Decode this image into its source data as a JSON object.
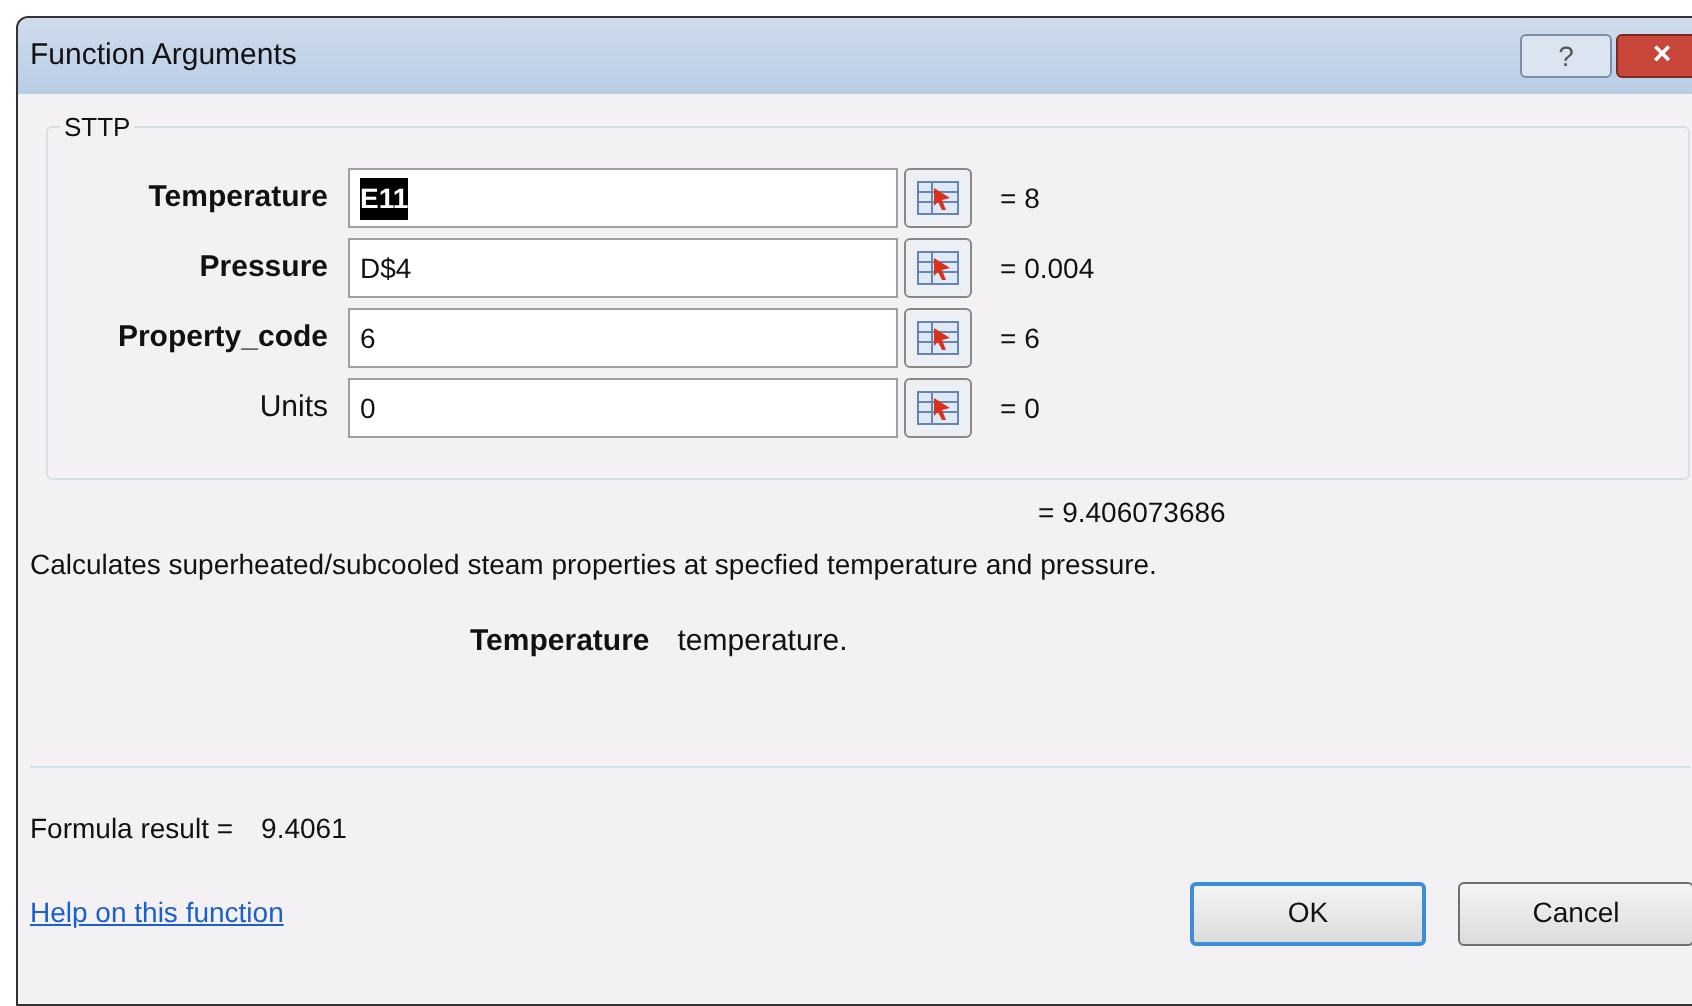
{
  "window": {
    "title": "Function Arguments",
    "buttons": [
      "?",
      "×"
    ]
  },
  "function_name": "STTP",
  "arguments": [
    {
      "label": "Temperature",
      "required": true,
      "value": "E11",
      "value_selected": true,
      "result": "= 8"
    },
    {
      "label": "Pressure",
      "required": true,
      "value": "D$4",
      "value_selected": false,
      "result": "= 0.004"
    },
    {
      "label": "Property_code",
      "required": true,
      "value": "6",
      "value_selected": false,
      "result": "= 6"
    },
    {
      "label": "Units",
      "required": false,
      "value": "0",
      "value_selected": false,
      "result": "= 0"
    }
  ],
  "function_result": "= 9.406073686",
  "description": "Calculates superheated/subcooled steam properties at specfied temperature and pressure.",
  "argument_help": {
    "name": "Temperature",
    "text": "temperature."
  },
  "formula_result": {
    "label": "Formula result =",
    "value": "9.4061"
  },
  "help_link": "Help on this function",
  "buttons": [
    {
      "label": "OK",
      "default": true
    },
    {
      "label": "Cancel",
      "default": false
    }
  ]
}
